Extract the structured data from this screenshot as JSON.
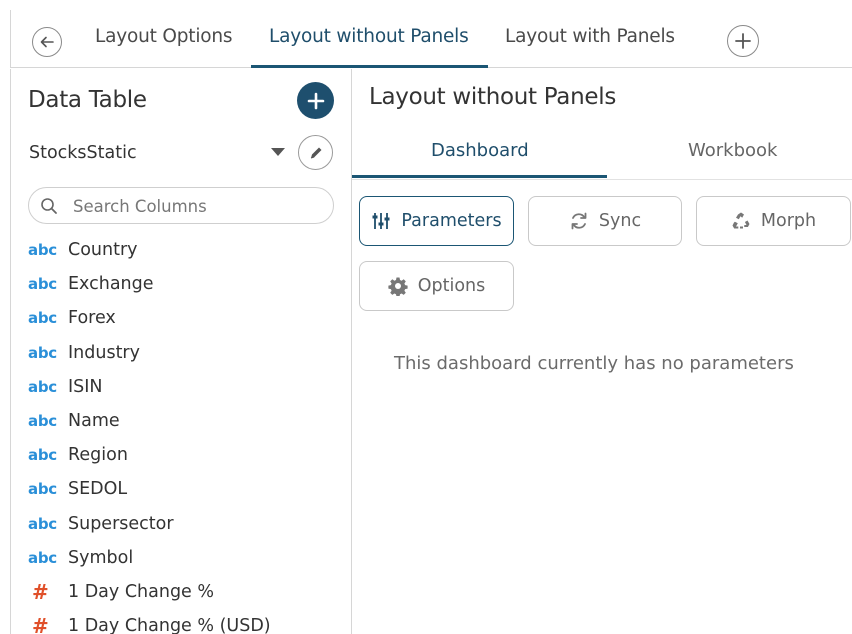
{
  "topbar": {
    "tabs": [
      {
        "label": "Layout Options"
      },
      {
        "label": "Layout without Panels",
        "active": true
      },
      {
        "label": "Layout with Panels"
      }
    ],
    "back_icon": "arrow-left-icon",
    "add_icon": "plus-icon"
  },
  "data_table": {
    "title": "Data Table",
    "source": "StocksStatic",
    "search_placeholder": "Search Columns",
    "columns": [
      {
        "type": "abc",
        "name": "Country"
      },
      {
        "type": "abc",
        "name": "Exchange"
      },
      {
        "type": "abc",
        "name": "Forex"
      },
      {
        "type": "abc",
        "name": "Industry"
      },
      {
        "type": "abc",
        "name": "ISIN"
      },
      {
        "type": "abc",
        "name": "Name"
      },
      {
        "type": "abc",
        "name": "Region"
      },
      {
        "type": "abc",
        "name": "SEDOL"
      },
      {
        "type": "abc",
        "name": "Supersector"
      },
      {
        "type": "abc",
        "name": "Symbol"
      },
      {
        "type": "#",
        "name": "1 Day Change %"
      },
      {
        "type": "#",
        "name": "1 Day Change % (USD)"
      }
    ]
  },
  "main": {
    "title": "Layout without Panels",
    "subtabs": [
      {
        "label": "Dashboard",
        "active": true
      },
      {
        "label": "Workbook"
      }
    ],
    "buttons": {
      "parameters": "Parameters",
      "sync": "Sync",
      "morph": "Morph",
      "options": "Options"
    },
    "empty_message": "This dashboard currently has no parameters"
  },
  "colors": {
    "accent": "#1b5674",
    "text_type": "#2a8fd8",
    "numeric_type": "#e0502a"
  }
}
